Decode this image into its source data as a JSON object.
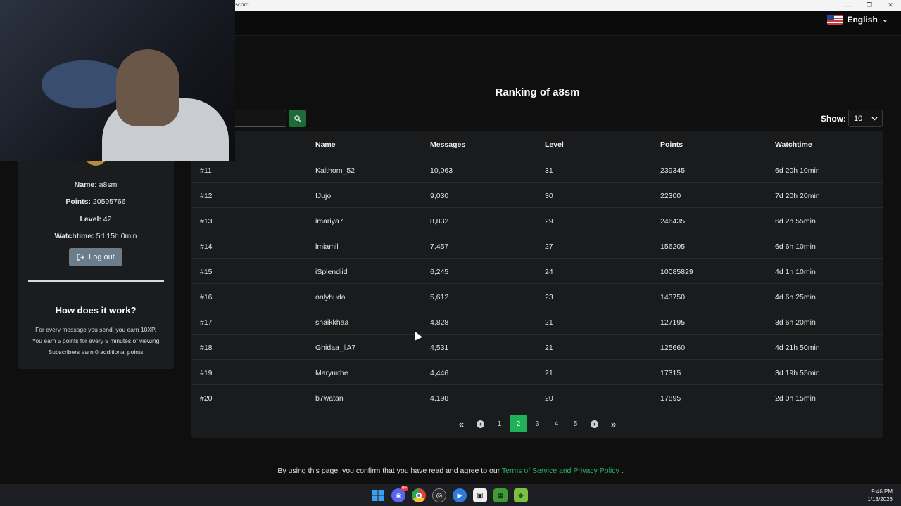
{
  "window": {
    "title": "scord",
    "controls": [
      "—",
      "❐",
      "✕"
    ]
  },
  "navbar": {
    "language": "English",
    "language_chevron": "⌄"
  },
  "profile": {
    "name_label": "Name:",
    "name": "a8sm",
    "points_label": "Points:",
    "points": "20595766",
    "level_label": "Level:",
    "level": "42",
    "watchtime_label": "Watchtime:",
    "watchtime": "5d 15h 0min",
    "logout_label": "Log out"
  },
  "how": {
    "title": "How does it work?",
    "lines": [
      "For every message you send, you earn 10XP.",
      "You earn 5 points for every 5 minutes of viewing",
      "Subscribers earn 0 additional points"
    ]
  },
  "ranking": {
    "title": "Ranking of a8sm",
    "show_label": "Show:",
    "show_value": "10",
    "columns": [
      "",
      "Name",
      "Messages",
      "Level",
      "Points",
      "Watchtime"
    ],
    "rows": [
      [
        "#11",
        "Kalthom_52",
        "10,063",
        "31",
        "239345",
        "6d 20h 10min"
      ],
      [
        "#12",
        "IJujo",
        "9,030",
        "30",
        "22300",
        "7d 20h 20min"
      ],
      [
        "#13",
        "imariya7",
        "8,832",
        "29",
        "246435",
        "6d 2h 55min"
      ],
      [
        "#14",
        "lmiamil",
        "7,457",
        "27",
        "156205",
        "6d 6h 10min"
      ],
      [
        "#15",
        "iSplendiid",
        "6,245",
        "24",
        "10085829",
        "4d 1h 10min"
      ],
      [
        "#16",
        "onlyhuda",
        "5,612",
        "23",
        "143750",
        "4d 6h 25min"
      ],
      [
        "#17",
        "shaikkhaa",
        "4,828",
        "21",
        "127195",
        "3d 6h 20min"
      ],
      [
        "#18",
        "Ghidaa_llA7",
        "4,531",
        "21",
        "125660",
        "4d 21h 50min"
      ],
      [
        "#19",
        "Marymthe",
        "4,446",
        "21",
        "17315",
        "3d 19h 55min"
      ],
      [
        "#20",
        "b7watan",
        "4,198",
        "20",
        "17895",
        "2d 0h 15min"
      ]
    ],
    "pagination": {
      "first": "«",
      "prev": "‹",
      "pages": [
        "1",
        "2",
        "3",
        "4",
        "5"
      ],
      "current": "2",
      "next": "›",
      "last": "»"
    }
  },
  "footer": {
    "text_before": "By using this page, you confirm that you have read and agree to our ",
    "link": "Terms of Service and Privacy Policy",
    "text_after": " ."
  },
  "taskbar": {
    "time": "9:46 PM",
    "date": "1/13/2026",
    "discord_badge": "9+"
  },
  "colors": {
    "accent_green": "#1fb05a",
    "link_green": "#27b36a",
    "logout_button": "#6b7d8a"
  }
}
